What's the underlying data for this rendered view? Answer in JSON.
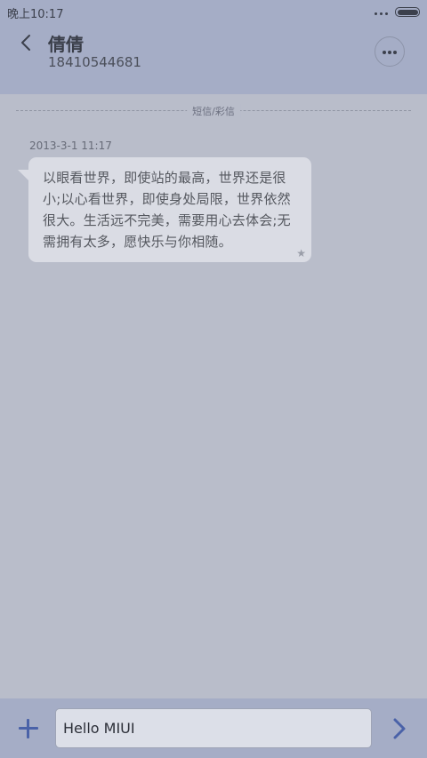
{
  "status_bar": {
    "time": "晚上10:17",
    "icons": [
      "more-dots-icon",
      "battery-icon"
    ]
  },
  "header": {
    "back_icon": "chevron-left-icon",
    "contact_name": "倩倩",
    "contact_number": "18410544681",
    "more_icon": "more-horizontal-icon"
  },
  "thread": {
    "divider_label": "短信/彩信",
    "messages": [
      {
        "timestamp": "2013-3-1 11:17",
        "text": "以眼看世界，即使站的最高，世界还是很小;以心看世界，即使身处局限，世界依然很大。生活远不完美，需要用心去体会;无需拥有太多，愿快乐与你相随。",
        "star_icon": "star-icon"
      }
    ]
  },
  "composer": {
    "add_icon": "plus-icon",
    "input_value": "Hello MIUI",
    "send_icon": "chevron-right-icon"
  },
  "colors": {
    "accent": "#4a62a8",
    "header_bg": "#a5adc6",
    "screen_bg": "#b9bdca",
    "bubble_bg": "#dadce4"
  }
}
